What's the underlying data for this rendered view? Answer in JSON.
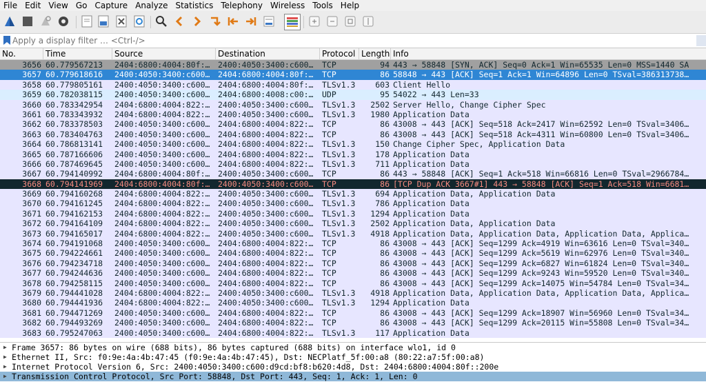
{
  "menu": [
    "File",
    "Edit",
    "View",
    "Go",
    "Capture",
    "Analyze",
    "Statistics",
    "Telephony",
    "Wireless",
    "Tools",
    "Help"
  ],
  "filter": {
    "placeholder": "Apply a display filter … <Ctrl-/>"
  },
  "columns": [
    "No.",
    "Time",
    "Source",
    "Destination",
    "Protocol",
    "Length",
    "Info"
  ],
  "colors": {
    "tcp": "#e7e6ff",
    "udp": "#daeeff",
    "selected": "#2f86d4",
    "dup": "#12272e",
    "dup_text": "#f78b80",
    "syn": "#a0a0a0"
  },
  "packets": [
    {
      "no": "3656",
      "time": "60.779567213",
      "src": "2404:6800:4004:80f:…",
      "dst": "2400:4050:3400:c600…",
      "proto": "TCP",
      "len": "94",
      "info": "443 → 58848 [SYN, ACK] Seq=0 Ack=1 Win=65535 Len=0 MSS=1440 SA",
      "style": "syn"
    },
    {
      "no": "3657",
      "time": "60.779618616",
      "src": "2400:4050:3400:c600…",
      "dst": "2404:6800:4004:80f:…",
      "proto": "TCP",
      "len": "86",
      "info": "58848 → 443 [ACK] Seq=1 Ack=1 Win=64896 Len=0 TSval=386313738…",
      "style": "selected"
    },
    {
      "no": "3658",
      "time": "60.779805161",
      "src": "2400:4050:3400:c600…",
      "dst": "2404:6800:4004:80f:…",
      "proto": "TLSv1.3",
      "len": "603",
      "info": "Client Hello",
      "style": "tcp"
    },
    {
      "no": "3659",
      "time": "60.782038115",
      "src": "2400:4050:3400:c600…",
      "dst": "2404:6800:4008:c00:…",
      "proto": "UDP",
      "len": "95",
      "info": "54022 → 443 Len=33",
      "style": "udp"
    },
    {
      "no": "3660",
      "time": "60.783342954",
      "src": "2404:6800:4004:822:…",
      "dst": "2400:4050:3400:c600…",
      "proto": "TLSv1.3",
      "len": "2502",
      "info": "Server Hello, Change Cipher Spec",
      "style": "tcp"
    },
    {
      "no": "3661",
      "time": "60.783343932",
      "src": "2404:6800:4004:822:…",
      "dst": "2400:4050:3400:c600…",
      "proto": "TLSv1.3",
      "len": "1980",
      "info": "Application Data",
      "style": "tcp"
    },
    {
      "no": "3662",
      "time": "60.783378503",
      "src": "2400:4050:3400:c600…",
      "dst": "2404:6800:4004:822:…",
      "proto": "TCP",
      "len": "86",
      "info": "43008 → 443 [ACK] Seq=518 Ack=2417 Win=62592 Len=0 TSval=3406…",
      "style": "tcp"
    },
    {
      "no": "3663",
      "time": "60.783404763",
      "src": "2400:4050:3400:c600…",
      "dst": "2404:6800:4004:822:…",
      "proto": "TCP",
      "len": "86",
      "info": "43008 → 443 [ACK] Seq=518 Ack=4311 Win=60800 Len=0 TSval=3406…",
      "style": "tcp"
    },
    {
      "no": "3664",
      "time": "60.786813141",
      "src": "2400:4050:3400:c600…",
      "dst": "2404:6800:4004:822:…",
      "proto": "TLSv1.3",
      "len": "150",
      "info": "Change Cipher Spec, Application Data",
      "style": "tcp"
    },
    {
      "no": "3665",
      "time": "60.787166606",
      "src": "2400:4050:3400:c600…",
      "dst": "2404:6800:4004:822:…",
      "proto": "TLSv1.3",
      "len": "178",
      "info": "Application Data",
      "style": "tcp"
    },
    {
      "no": "3666",
      "time": "60.787469645",
      "src": "2400:4050:3400:c600…",
      "dst": "2404:6800:4004:822:…",
      "proto": "TLSv1.3",
      "len": "711",
      "info": "Application Data",
      "style": "tcp"
    },
    {
      "no": "3667",
      "time": "60.794140992",
      "src": "2404:6800:4004:80f:…",
      "dst": "2400:4050:3400:c600…",
      "proto": "TCP",
      "len": "86",
      "info": "443 → 58848 [ACK] Seq=1 Ack=518 Win=66816 Len=0 TSval=2966784…",
      "style": "tcp"
    },
    {
      "no": "3668",
      "time": "60.794141969",
      "src": "2404:6800:4004:80f:…",
      "dst": "2400:4050:3400:c600…",
      "proto": "TCP",
      "len": "86",
      "info": "[TCP Dup ACK 3667#1] 443 → 58848 [ACK] Seq=1 Ack=518 Win=6681…",
      "style": "dup"
    },
    {
      "no": "3669",
      "time": "60.794160268",
      "src": "2404:6800:4004:822:…",
      "dst": "2400:4050:3400:c600…",
      "proto": "TLSv1.3",
      "len": "694",
      "info": "Application Data, Application Data",
      "style": "tcp"
    },
    {
      "no": "3670",
      "time": "60.794161245",
      "src": "2404:6800:4004:822:…",
      "dst": "2400:4050:3400:c600…",
      "proto": "TLSv1.3",
      "len": "786",
      "info": "Application Data",
      "style": "tcp"
    },
    {
      "no": "3671",
      "time": "60.794162153",
      "src": "2404:6800:4004:822:…",
      "dst": "2400:4050:3400:c600…",
      "proto": "TLSv1.3",
      "len": "1294",
      "info": "Application Data",
      "style": "tcp"
    },
    {
      "no": "3672",
      "time": "60.794164109",
      "src": "2404:6800:4004:822:…",
      "dst": "2400:4050:3400:c600…",
      "proto": "TLSv1.3",
      "len": "2502",
      "info": "Application Data, Application Data",
      "style": "tcp"
    },
    {
      "no": "3673",
      "time": "60.794165017",
      "src": "2404:6800:4004:822:…",
      "dst": "2400:4050:3400:c600…",
      "proto": "TLSv1.3",
      "len": "4918",
      "info": "Application Data, Application Data, Application Data, Applica…",
      "style": "tcp"
    },
    {
      "no": "3674",
      "time": "60.794191068",
      "src": "2400:4050:3400:c600…",
      "dst": "2404:6800:4004:822:…",
      "proto": "TCP",
      "len": "86",
      "info": "43008 → 443 [ACK] Seq=1299 Ack=4919 Win=63616 Len=0 TSval=340…",
      "style": "tcp"
    },
    {
      "no": "3675",
      "time": "60.794224661",
      "src": "2400:4050:3400:c600…",
      "dst": "2404:6800:4004:822:…",
      "proto": "TCP",
      "len": "86",
      "info": "43008 → 443 [ACK] Seq=1299 Ack=5619 Win=62976 Len=0 TSval=340…",
      "style": "tcp"
    },
    {
      "no": "3676",
      "time": "60.794234718",
      "src": "2400:4050:3400:c600…",
      "dst": "2404:6800:4004:822:…",
      "proto": "TCP",
      "len": "86",
      "info": "43008 → 443 [ACK] Seq=1299 Ack=6827 Win=61824 Len=0 TSval=340…",
      "style": "tcp"
    },
    {
      "no": "3677",
      "time": "60.794244636",
      "src": "2400:4050:3400:c600…",
      "dst": "2404:6800:4004:822:…",
      "proto": "TCP",
      "len": "86",
      "info": "43008 → 443 [ACK] Seq=1299 Ack=9243 Win=59520 Len=0 TSval=340…",
      "style": "tcp"
    },
    {
      "no": "3678",
      "time": "60.794258115",
      "src": "2400:4050:3400:c600…",
      "dst": "2404:6800:4004:822:…",
      "proto": "TCP",
      "len": "86",
      "info": "43008 → 443 [ACK] Seq=1299 Ack=14075 Win=54784 Len=0 TSval=34…",
      "style": "tcp"
    },
    {
      "no": "3679",
      "time": "60.794441028",
      "src": "2404:6800:4004:822:…",
      "dst": "2400:4050:3400:c600…",
      "proto": "TLSv1.3",
      "len": "4918",
      "info": "Application Data, Application Data, Application Data, Applica…",
      "style": "tcp"
    },
    {
      "no": "3680",
      "time": "60.794441936",
      "src": "2404:6800:4004:822:…",
      "dst": "2400:4050:3400:c600…",
      "proto": "TLSv1.3",
      "len": "1294",
      "info": "Application Data",
      "style": "tcp"
    },
    {
      "no": "3681",
      "time": "60.794471269",
      "src": "2400:4050:3400:c600…",
      "dst": "2404:6800:4004:822:…",
      "proto": "TCP",
      "len": "86",
      "info": "43008 → 443 [ACK] Seq=1299 Ack=18907 Win=56960 Len=0 TSval=34…",
      "style": "tcp"
    },
    {
      "no": "3682",
      "time": "60.794493269",
      "src": "2400:4050:3400:c600…",
      "dst": "2404:6800:4004:822:…",
      "proto": "TCP",
      "len": "86",
      "info": "43008 → 443 [ACK] Seq=1299 Ack=20115 Win=55808 Len=0 TSval=34…",
      "style": "tcp"
    },
    {
      "no": "3683",
      "time": "60.795247063",
      "src": "2400:4050:3400:c600…",
      "dst": "2404:6800:4004:822:…",
      "proto": "TLSv1.3",
      "len": "117",
      "info": "Application Data",
      "style": "tcp"
    }
  ],
  "details": [
    {
      "text": "Frame 3657: 86 bytes on wire (688 bits), 86 bytes captured (688 bits) on interface wlo1, id 0",
      "selected": false
    },
    {
      "text": "Ethernet II, Src: f0:9e:4a:4b:47:45 (f0:9e:4a:4b:47:45), Dst: NECPlatf_5f:00:a8 (80:22:a7:5f:00:a8)",
      "selected": false
    },
    {
      "text": "Internet Protocol Version 6, Src: 2400:4050:3400:c600:d9cd:bf8:b620:4d8, Dst: 2404:6800:4004:80f::200e",
      "selected": false
    },
    {
      "text": "Transmission Control Protocol, Src Port: 58848, Dst Port: 443, Seq: 1, Ack: 1, Len: 0",
      "selected": true
    }
  ]
}
